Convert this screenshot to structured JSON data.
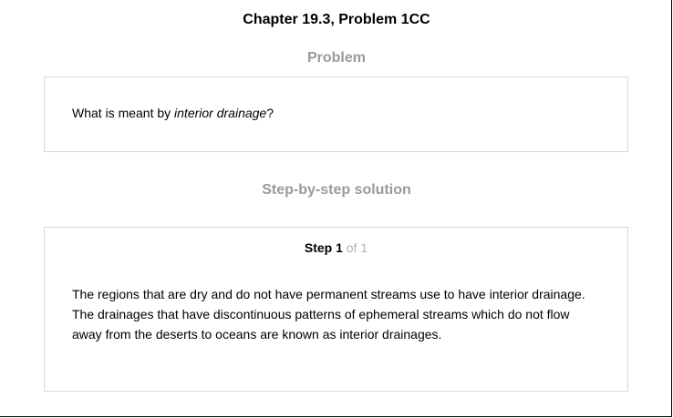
{
  "title": "Chapter 19.3, Problem 1CC",
  "problem": {
    "heading": "Problem",
    "text_before": "What is meant by ",
    "text_italic": "interior drainage",
    "text_after": "?"
  },
  "solution": {
    "heading": "Step-by-step solution",
    "step_label": "Step 1",
    "step_total": "of 1",
    "lines": [
      "The regions that are dry and do not have permanent streams use to have interior drainage.",
      "The drainages that have discontinuous patterns of ephemeral streams which do not flow",
      "away from the deserts to oceans are known as interior drainages."
    ]
  }
}
